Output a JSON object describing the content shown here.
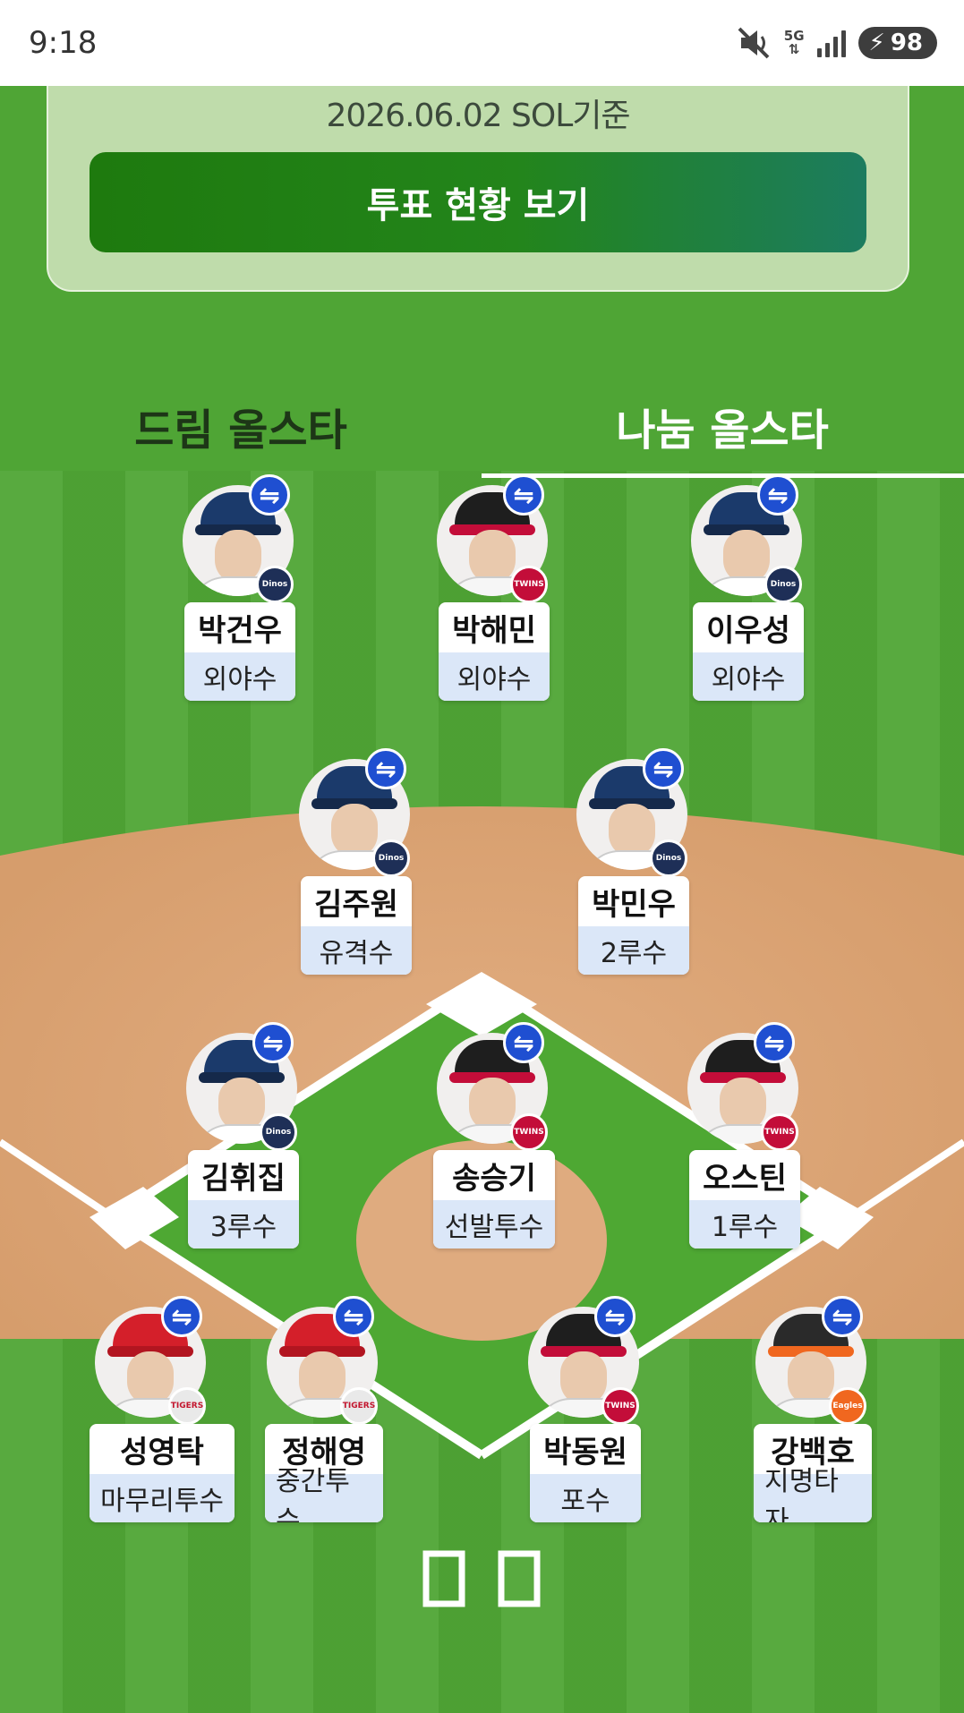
{
  "status_bar": {
    "time": "9:18",
    "network": "5G",
    "battery": "98"
  },
  "info": {
    "date_text": "2026.06.02 SOL기준",
    "vote_button": "투표 현황 보기"
  },
  "tabs": [
    {
      "label": "드림 올스타",
      "selected": false
    },
    {
      "label": "나눔 올스타",
      "selected": true
    }
  ],
  "swap_glyph": "⇋",
  "colors": {
    "accent_green": "#1e7a0e",
    "swap_blue": "#1f4fd1",
    "field_green": "#4fa535",
    "infield_dirt": "#dda77a"
  },
  "players": [
    {
      "name": "박건우",
      "position": "외야수",
      "team": "dinos",
      "team_label": "Dinos"
    },
    {
      "name": "박해민",
      "position": "외야수",
      "team": "twins",
      "team_label": "TWINS"
    },
    {
      "name": "이우성",
      "position": "외야수",
      "team": "dinos",
      "team_label": "Dinos"
    },
    {
      "name": "김주원",
      "position": "유격수",
      "team": "dinos",
      "team_label": "Dinos"
    },
    {
      "name": "박민우",
      "position": "2루수",
      "team": "dinos",
      "team_label": "Dinos"
    },
    {
      "name": "김휘집",
      "position": "3루수",
      "team": "dinos",
      "team_label": "Dinos"
    },
    {
      "name": "송승기",
      "position": "선발투수",
      "team": "twins",
      "team_label": "TWINS"
    },
    {
      "name": "오스틴",
      "position": "1루수",
      "team": "twins",
      "team_label": "TWINS"
    },
    {
      "name": "성영탁",
      "position": "마무리투수",
      "team": "tigers",
      "team_label": "TIGERS"
    },
    {
      "name": "정해영",
      "position": "중간투수",
      "team": "tigers",
      "team_label": "TIGERS"
    },
    {
      "name": "박동원",
      "position": "포수",
      "team": "twins",
      "team_label": "TWINS"
    },
    {
      "name": "강백호",
      "position": "지명타자",
      "team": "eagles",
      "team_label": "Eagles"
    }
  ]
}
